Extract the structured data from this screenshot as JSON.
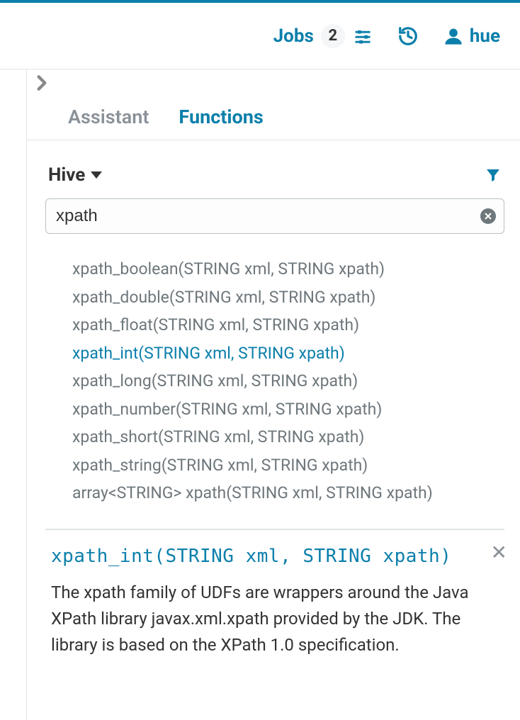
{
  "topbar": {
    "jobs_label": "Jobs",
    "jobs_count": "2",
    "username": "hue"
  },
  "tabs": {
    "assistant": "Assistant",
    "functions": "Functions"
  },
  "dialect": {
    "label": "Hive"
  },
  "search": {
    "value": "xpath"
  },
  "functions": [
    "xpath_boolean(STRING xml, STRING xpath)",
    "xpath_double(STRING xml, STRING xpath)",
    "xpath_float(STRING xml, STRING xpath)",
    "xpath_int(STRING xml, STRING xpath)",
    "xpath_long(STRING xml, STRING xpath)",
    "xpath_number(STRING xml, STRING xpath)",
    "xpath_short(STRING xml, STRING xpath)",
    "xpath_string(STRING xml, STRING xpath)",
    "array<STRING> xpath(STRING xml, STRING xpath)"
  ],
  "selected_index": 3,
  "detail": {
    "title": "xpath_int(STRING xml, STRING xpath)",
    "body": "The xpath family of UDFs are wrappers around the Java XPath library javax.xml.xpath provided by the JDK. The library is based on the XPath 1.0 specification."
  }
}
